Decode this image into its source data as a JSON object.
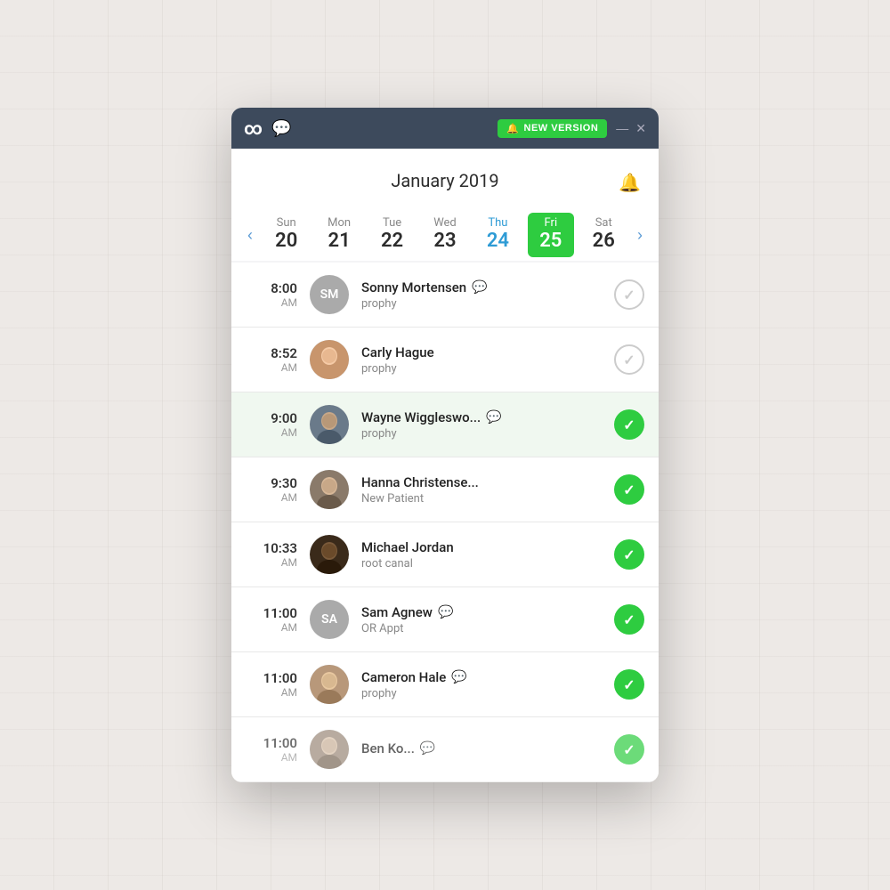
{
  "titlebar": {
    "logo": "∞",
    "chat_icon": "💬",
    "new_version_label": "NEW VERSION",
    "bell_icon": "🔔",
    "minimize": "—",
    "close": "✕"
  },
  "header": {
    "month_year": "January 2019",
    "bell_icon": "🔔"
  },
  "calendar": {
    "prev_arrow": "‹",
    "next_arrow": "›",
    "days": [
      {
        "name": "Sun",
        "num": "20",
        "active": false,
        "today": false
      },
      {
        "name": "Mon",
        "num": "21",
        "active": false,
        "today": false
      },
      {
        "name": "Tue",
        "num": "22",
        "active": false,
        "today": false
      },
      {
        "name": "Wed",
        "num": "23",
        "active": false,
        "today": false
      },
      {
        "name": "Thu",
        "num": "24",
        "active": false,
        "today": true
      },
      {
        "name": "Fri",
        "num": "25",
        "active": true,
        "today": false
      },
      {
        "name": "Sat",
        "num": "26",
        "active": false,
        "today": false
      }
    ]
  },
  "appointments": [
    {
      "time": "8:00",
      "ampm": "AM",
      "avatar_initials": "SM",
      "avatar_type": "initials",
      "avatar_color": "av-gray",
      "name": "Sonny Mortensen",
      "has_chat": true,
      "type": "prophy",
      "checked": false,
      "highlighted": false
    },
    {
      "time": "8:52",
      "ampm": "AM",
      "avatar_initials": "",
      "avatar_type": "photo",
      "avatar_color": "av-photo-carly",
      "name": "Carly Hague",
      "has_chat": false,
      "type": "prophy",
      "checked": false,
      "highlighted": false
    },
    {
      "time": "9:00",
      "ampm": "AM",
      "avatar_initials": "",
      "avatar_type": "photo",
      "avatar_color": "av-photo-wayne",
      "name": "Wayne Wiggleswo...",
      "has_chat": true,
      "type": "prophy",
      "checked": true,
      "highlighted": true
    },
    {
      "time": "9:30",
      "ampm": "AM",
      "avatar_initials": "",
      "avatar_type": "photo",
      "avatar_color": "av-photo-hanna",
      "name": "Hanna Christense...",
      "has_chat": false,
      "type": "New Patient",
      "checked": true,
      "highlighted": false
    },
    {
      "time": "10:33",
      "ampm": "AM",
      "avatar_initials": "",
      "avatar_type": "photo",
      "avatar_color": "av-photo-michael",
      "name": "Michael Jordan",
      "has_chat": false,
      "type": "root canal",
      "checked": true,
      "highlighted": false
    },
    {
      "time": "11:00",
      "ampm": "AM",
      "avatar_initials": "SA",
      "avatar_type": "initials",
      "avatar_color": "av-gray",
      "name": "Sam Agnew",
      "has_chat": true,
      "type": "OR Appt",
      "checked": true,
      "highlighted": false
    },
    {
      "time": "11:00",
      "ampm": "AM",
      "avatar_initials": "",
      "avatar_type": "photo",
      "avatar_color": "av-photo-cameron",
      "name": "Cameron Hale",
      "has_chat": true,
      "type": "prophy",
      "checked": true,
      "highlighted": false
    },
    {
      "time": "11:00",
      "ampm": "AM",
      "avatar_initials": "",
      "avatar_type": "photo",
      "avatar_color": "av-photo-ben",
      "name": "Ben Ko...",
      "has_chat": true,
      "type": "",
      "checked": true,
      "highlighted": false,
      "partial": true
    }
  ],
  "icons": {
    "check": "✓",
    "chat": "💬"
  }
}
